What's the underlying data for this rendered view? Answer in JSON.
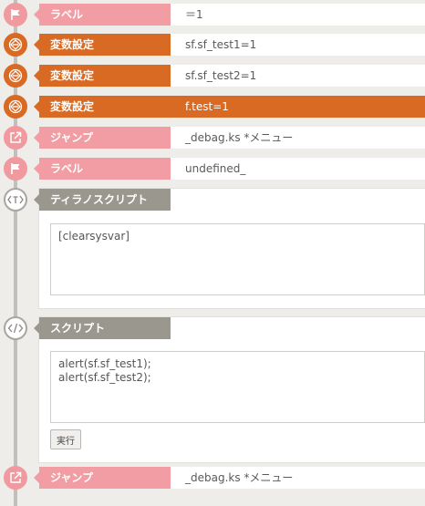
{
  "rows": [
    {
      "label": "ラベル",
      "value": "＝1",
      "type": "label",
      "icon": "flag-icon"
    },
    {
      "label": "変数設定",
      "value": "sf.sf_test1=1",
      "type": "variable",
      "icon": "variable-icon"
    },
    {
      "label": "変数設定",
      "value": "sf.sf_test2=1",
      "type": "variable",
      "icon": "variable-icon"
    },
    {
      "label": "変数設定",
      "value": "f.test=1",
      "type": "variable",
      "icon": "variable-icon",
      "selected": true
    },
    {
      "label": "ジャンプ",
      "value": "_debag.ks *メニュー",
      "type": "jump",
      "icon": "jump-icon"
    },
    {
      "label": "ラベル",
      "value": "undefined_",
      "type": "label",
      "icon": "flag-icon"
    }
  ],
  "tyrano_script": {
    "label": "ティラノスクリプト",
    "icon": "tag-icon",
    "code": "[clearsysvar]"
  },
  "script": {
    "label": "スクリプト",
    "icon": "code-icon",
    "code": "alert(sf.sf_test1);\nalert(sf.sf_test2);",
    "run_label": "実行"
  },
  "last_row": {
    "label": "ジャンプ",
    "value": "_debag.ks *メニュー",
    "type": "jump",
    "icon": "jump-icon"
  },
  "colors": {
    "label_pink": "#f19da3",
    "variable_orange": "#d86a24",
    "script_gray": "#9a978f",
    "background": "#efedea"
  }
}
